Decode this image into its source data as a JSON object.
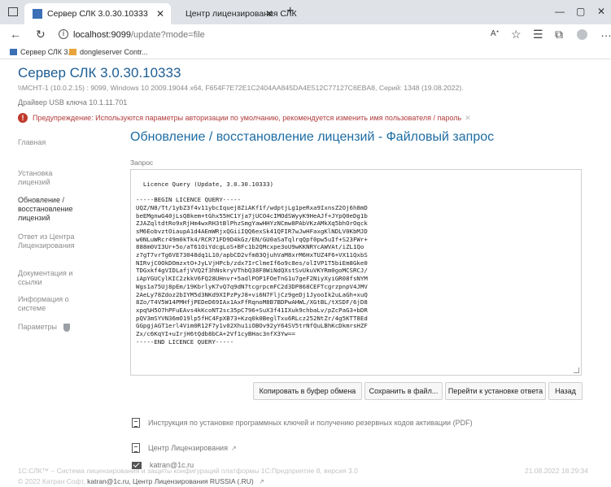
{
  "browser": {
    "tabs": [
      {
        "title": "Сервер СЛК 3.0.30.10333"
      },
      {
        "title": "Центр лицензирования СЛК"
      }
    ],
    "address": {
      "host": "localhost:9099",
      "path": "/update?mode=file"
    },
    "favorites": [
      {
        "label": "Сервер СЛК 3.0"
      },
      {
        "label": "dongleserver Contr..."
      }
    ]
  },
  "page": {
    "title": "Сервер СЛК 3.0.30.10333",
    "info_line": "\\\\МСНТ-1 (10.0.2.15) : 9099,  Windows 10 2009.19044 x64,  F654F7E72E1C2404AA845DA4E512C77127C6EBA8,  Серий: 1348 (19.08.2022).",
    "driver": "Драйвер USB ключа 10.1.11.701",
    "warning": "Предупреждение: Используются параметры авторизации по умолчанию, рекомендуется изменить имя пользователя / пароль"
  },
  "sidebar": {
    "items": [
      {
        "label": "Главная"
      },
      {
        "label": "Установка\nлицензий"
      },
      {
        "label": "Обновление /\nвосстановление\nлицензий"
      },
      {
        "label": "Ответ из Центра\nЛицензирования"
      },
      {
        "label": "Документация и\nссылки"
      },
      {
        "label": "Информация о\nсистеме"
      },
      {
        "label": "Параметры"
      }
    ]
  },
  "main": {
    "heading": "Обновление / восстановление лицензий - Файловый запрос",
    "query_label": "Запрос",
    "query_text": "Licence Query (Update, 3.0.30.10333)\n\n-----BEGIN LICENCE QUERY-----\nUQZ/N8/Tt/1ybZ3f4v11ybcIquej8ZiAKf1f/wdptjLg1peRxa9IxnsZ2Oj6h8mD\nbeEMgnwG40jLsQ8kem+tGhx55HC1Yja7jUCO4cIMOdSWyyK9HeAJf+JYpQ0eDg1b\nZJAZqltdtRo9xRjHm4wxRH3tBlPhzSmgYawHHYzNCmw8PAbVKzAMkXq5bhOrOqck\nsM6EobvztOiaupA1d4AEmWRjxQGiiIQQ6exSk41QFIR7wJwHFaxgKlNDLV0KbMJD\nw0NLuWRcr49m0kTk4/RCR71FD9D4kGz/EN/GU0aSaTqlrqQpf0pw5uIf+S23FWr+\n888m0VI3Ur+5o/aT61OiYdcgLoS+BFc1b2QMcxpe3oU9wKKNRYcAWVAt/iZL1Qo\nz7gT7vrTg6VE73048dq1L10/apbCD2vfm83QjuhVaM8xrM6HxTUZ4F6+VX11QxbS\nNIRvjC0OkDOmzxtO+JyLVjHPcb/zdx7IrClmeIf6o9c8es/olIVP1T5biEm8Gke0\nTDGxkf4gVIDLafjVVQ2f3hNskryVThbQ38F8WiNdQXstSvUkuVKYRm0goMCSRCJ/\niApYGUCylKIC2zkkV6FQ28UHnvr+5adlPOP1FOeTnG1u7geF2NiyXyiGR08fsNYM\nWgs1a75Uj8pEm/19KbrlyK7vQ7q9dN7tcgrpcmFC2d3DP868CEFTcgrzpnpV4JMV\n2AeLy78Zdoz2bIYM5d3NKd9XIPzPyJ8+vi6N7FljCz9geDj1JyooIk2uLaGh+xuQ\n8Zo/T4V5W14PMHfjPEDeD69IAx1AxFfRqnoM8B7BDPwAHWL/XGtBL/tXSDF/6jD8\nxpq%H5O7hPFuEAvs4kKcoNT2sc35pC796+SuX3f41IXuk9chbaLv/pZcPaG3+bDR\npQV3mSYVN36mO19lp5fHC4FpXB73+Kzq0k0BeglTxu6RLcz252NtZr/4g5KTT8Ed\nGGpgjAGT1erl4Vim0R12F7y1v02Xhu1iOBOv92yY64SV5trNfQuLBhKcDkmrsHZF\nZx/c6KqYI+uIrjH6tQdb8bCA+2Vf1cyBHac3nfX3Yw==\n-----END LICENCE QUERY-----",
    "buttons": {
      "copy": "Копировать в буфер обмена",
      "save": "Сохранить в файл...",
      "goto": "Перейти к установке ответа",
      "back": "Назад"
    },
    "links": {
      "pdf": "Инструкция по установке программных ключей и получению резервных кодов активации (PDF)",
      "center": "Центр Лицензирования",
      "email": "katran@1c.ru"
    }
  },
  "footer": {
    "line1": "1С:СЛК™ – Система лицензирования и защиты конфигураций платформы 1С:Предприятие 8, версия 3.0",
    "timestamp": "21.08.2022 18:29:34",
    "prefix": "© 2022 Катран Софт,",
    "email": "katran@1c.ru,",
    "suffix": "Центр Лицензирования RUSSIA (.RU)"
  }
}
